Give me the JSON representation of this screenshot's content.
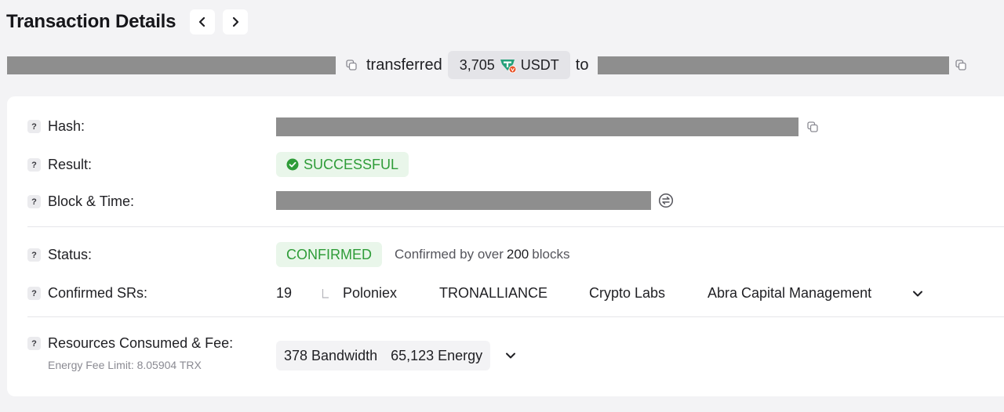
{
  "header": {
    "title": "Transaction Details",
    "prev_icon": "chevron-left-icon",
    "next_icon": "chevron-right-icon"
  },
  "transfer": {
    "verb": "transferred",
    "amount": "3,705",
    "token": "USDT",
    "preposition": "to"
  },
  "details": {
    "hash": {
      "label": "Hash:"
    },
    "result": {
      "label": "Result:",
      "value": "SUCCESSFUL"
    },
    "block_time": {
      "label": "Block & Time:"
    },
    "status": {
      "label": "Status:",
      "value": "CONFIRMED",
      "note_prefix": "Confirmed by over",
      "note_count": "200",
      "note_suffix": "blocks"
    },
    "confirmed_srs": {
      "label": "Confirmed SRs:",
      "count": "19",
      "names": [
        "Poloniex",
        "TRONALLIANCE",
        "Crypto Labs",
        "Abra Capital Management"
      ]
    },
    "resources": {
      "label": "Resources Consumed & Fee:",
      "sub_label": "Energy Fee Limit: 8.05904 TRX",
      "bandwidth": "378 Bandwidth",
      "energy": "65,123 Energy"
    }
  },
  "colors": {
    "success_green": "#2e9c38",
    "success_bg": "#e9f6ea",
    "token_teal": "#26a17b",
    "token_badge_red": "#e8542a"
  }
}
